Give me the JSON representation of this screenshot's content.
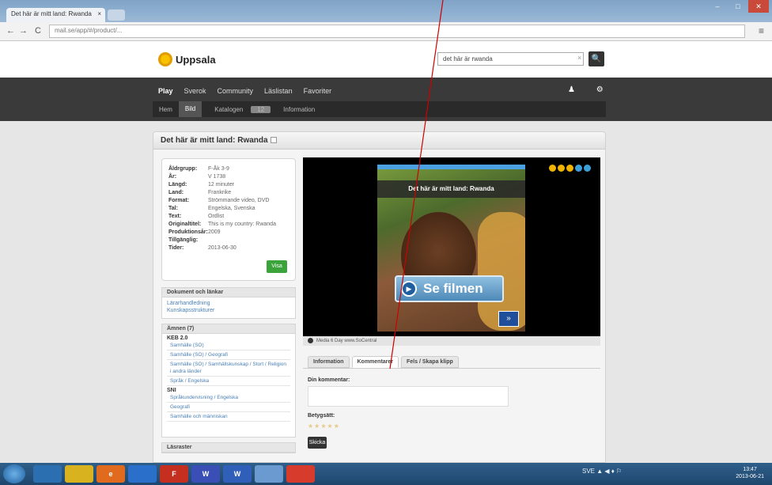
{
  "browser": {
    "tab_title": "Det här är mitt land: Rwanda",
    "tab_close": "×",
    "back": "←",
    "forward": "→",
    "reload": "C",
    "url": "mail.se/app/#/product/...",
    "menu": "≡",
    "minimize": "–",
    "maximize": "□",
    "close": "✕"
  },
  "site": {
    "logo": "Uppsala",
    "search_value": "det här är rwanda",
    "search_clear": "×",
    "search_btn": "🔍",
    "nav": [
      "Play",
      "Sverok",
      "Community",
      "Läslistan",
      "Favoriter"
    ],
    "nav_icons": "♟ ⚙",
    "subnav": [
      "Hem",
      "Bild",
      "Katalogen",
      "Information"
    ],
    "subnav_badge": "12"
  },
  "product": {
    "title": "Det här är mitt land: Rwanda",
    "info": [
      {
        "k": "Åldrgrupp:",
        "v": "F-Åk 3-9"
      },
      {
        "k": "År:",
        "v": "V 1738"
      },
      {
        "k": "Längd:",
        "v": "12 minuter"
      },
      {
        "k": "Land:",
        "v": "Frankrike"
      },
      {
        "k": "Format:",
        "v": "Strömmande video, DVD"
      },
      {
        "k": "Tal:",
        "v": "Engelska, Svenska"
      },
      {
        "k": "Text:",
        "v": "Ordlist"
      },
      {
        "k": "Originaltitel:",
        "v": "This is my country: Rwanda"
      },
      {
        "k": "Produktionsår:",
        "v": "2009"
      },
      {
        "k": "Tillgänglig:",
        "v": ""
      },
      {
        "k": "Tider:",
        "v": "2013-06-30"
      }
    ],
    "visa_btn": "Visa",
    "panel1_head": "Dokument och länkar",
    "panel1_links": [
      "Lärarhandledning",
      "Kunskapsstrukturer"
    ],
    "panel2_head": "Ämnen (7)",
    "panel2_groups": [
      {
        "name": "KEB 2.0",
        "items": [
          "Samhälle (SO)",
          "Samhälle (SO) / Geografi",
          "Samhälle (SO) / Samhällskunskap / Stort / Religion i andra länder",
          "Språk / Engelska"
        ]
      },
      {
        "name": "SNI",
        "items": [
          "Språkundervisning / Engelska",
          "Geografi",
          "Samhälle och människan"
        ]
      }
    ],
    "panel3_head": "Läsraster",
    "video_title": "Det här är mitt land: Rwanda",
    "se_filmen": "Se filmen",
    "se_icon": "▶",
    "next_icon": "»",
    "video_caption": "Media 6 Day www.SoCentral",
    "tabs": [
      "Information",
      "Kommentarer",
      "Fels / Skapa klipp"
    ],
    "comment_label": "Din kommentar:",
    "rating_label": "Betygsätt:",
    "stars": "★★★★★",
    "send_btn": "Skicka"
  },
  "taskbar": {
    "apps": [
      "",
      "",
      "e",
      "",
      "F",
      "W",
      "W",
      "",
      ""
    ],
    "tray": "SVE ▲ ◀ ♦ ⚐",
    "time": "13:47",
    "date": "2013-06-21"
  }
}
